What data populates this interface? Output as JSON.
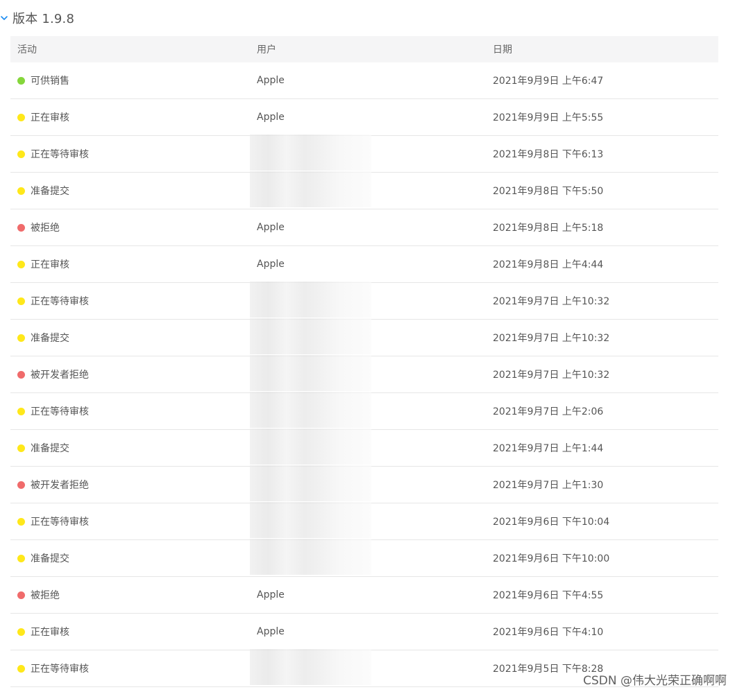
{
  "section": {
    "title": "版本 1.9.8",
    "expanded": true,
    "chevron_color": "#1a8bf0"
  },
  "table": {
    "headers": {
      "activity": "活动",
      "user": "用户",
      "date": "日期"
    },
    "status_colors": {
      "green": "#85d63b",
      "yellow": "#ffe81a",
      "red": "#f06b6b"
    },
    "rows": [
      {
        "status": "green",
        "activity": "可供销售",
        "user": "Apple",
        "date": "2021年9月9日 上午6:47"
      },
      {
        "status": "yellow",
        "activity": "正在审核",
        "user": "Apple",
        "date": "2021年9月9日 上午5:55"
      },
      {
        "status": "yellow",
        "activity": "正在等待审核",
        "user": "",
        "date": "2021年9月8日 下午6:13"
      },
      {
        "status": "yellow",
        "activity": "准备提交",
        "user": "",
        "date": "2021年9月8日 下午5:50"
      },
      {
        "status": "red",
        "activity": "被拒绝",
        "user": "Apple",
        "date": "2021年9月8日 上午5:18"
      },
      {
        "status": "yellow",
        "activity": "正在审核",
        "user": "Apple",
        "date": "2021年9月8日 上午4:44"
      },
      {
        "status": "yellow",
        "activity": "正在等待审核",
        "user": "",
        "date": "2021年9月7日 上午10:32"
      },
      {
        "status": "yellow",
        "activity": "准备提交",
        "user": "",
        "date": "2021年9月7日 上午10:32"
      },
      {
        "status": "red",
        "activity": "被开发者拒绝",
        "user": "",
        "date": "2021年9月7日 上午10:32"
      },
      {
        "status": "yellow",
        "activity": "正在等待审核",
        "user": "",
        "date": "2021年9月7日 上午2:06"
      },
      {
        "status": "yellow",
        "activity": "准备提交",
        "user": "",
        "date": "2021年9月7日 上午1:44"
      },
      {
        "status": "red",
        "activity": "被开发者拒绝",
        "user": "",
        "date": "2021年9月7日 上午1:30"
      },
      {
        "status": "yellow",
        "activity": "正在等待审核",
        "user": "",
        "date": "2021年9月6日 下午10:04"
      },
      {
        "status": "yellow",
        "activity": "准备提交",
        "user": "",
        "date": "2021年9月6日 下午10:00"
      },
      {
        "status": "red",
        "activity": "被拒绝",
        "user": "Apple",
        "date": "2021年9月6日 下午4:55"
      },
      {
        "status": "yellow",
        "activity": "正在审核",
        "user": "Apple",
        "date": "2021年9月6日 下午4:10"
      },
      {
        "status": "yellow",
        "activity": "正在等待审核",
        "user": "",
        "date": "2021年9月5日 下午8:28"
      }
    ]
  },
  "watermark": "CSDN @伟大光荣正确啊啊"
}
